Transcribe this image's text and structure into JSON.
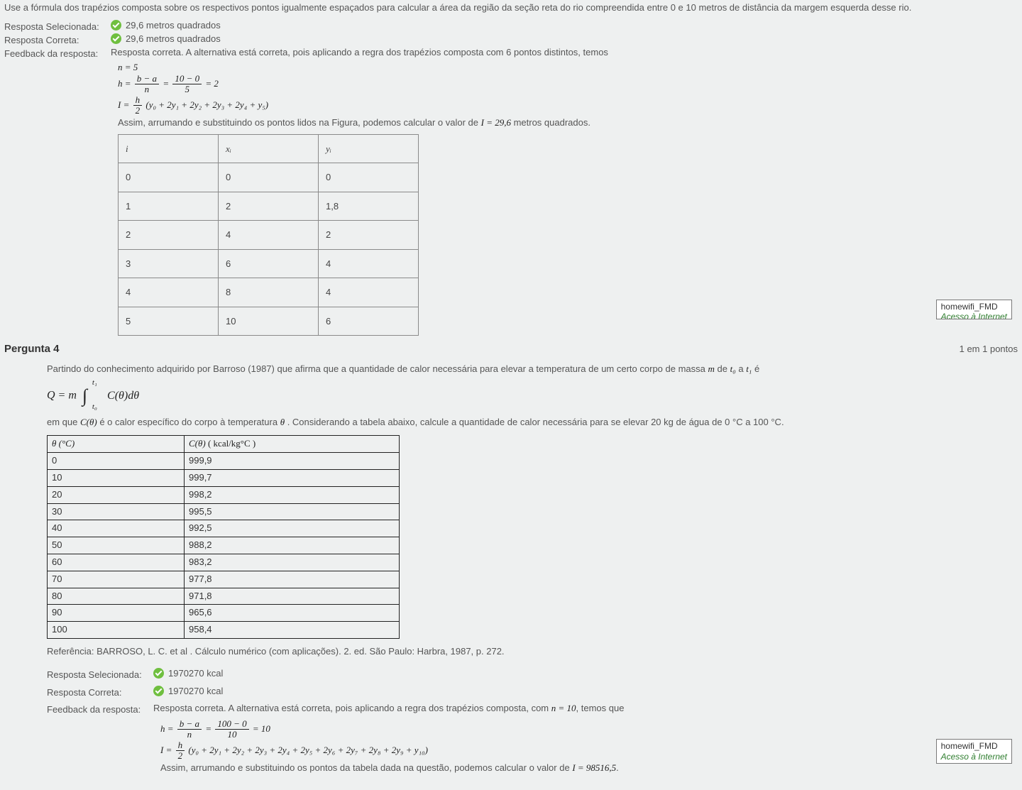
{
  "q3": {
    "prompt": "Use a fórmula dos trapézios composta sobre os respectivos pontos igualmente espaçados para calcular a área da região da seção reta do rio compreendida entre 0 e 10 metros de distância da margem esquerda desse rio.",
    "selected_label": "Resposta Selecionada:",
    "selected_value": "29,6 metros quadrados",
    "correct_label": "Resposta Correta:",
    "correct_value": "29,6 metros quadrados",
    "feedback_label": "Feedback da resposta:",
    "feedback_lead": "Resposta correta. A alternativa está correta, pois aplicando a regra dos trapézios composta com 6 pontos distintos, temos",
    "n_eq": "n = 5",
    "h_lhs": "h =",
    "h_frac_n": "b − a",
    "h_frac_d": "n",
    "h_eq2": "=",
    "h_frac2_n": "10 − 0",
    "h_frac2_d": "5",
    "h_val": "= 2",
    "I_lhs": "I =",
    "I_frac_n": "h",
    "I_frac_d": "2",
    "I_terms": "(y₀ + 2y₁ + 2y₂ + 2y₃ + 2y₄ + y₅)",
    "concl_a": "Assim, arrumando e substituindo os pontos lidos na Figura, podemos calcular o valor de ",
    "concl_b": "I = 29,6",
    "concl_c": " metros quadrados.",
    "table_head": {
      "c0": "i",
      "c1": "xᵢ",
      "c2": "yᵢ"
    },
    "table_rows": [
      {
        "i": "0",
        "x": "0",
        "y": "0"
      },
      {
        "i": "1",
        "x": "2",
        "y": "1,8"
      },
      {
        "i": "2",
        "x": "4",
        "y": "2"
      },
      {
        "i": "3",
        "x": "6",
        "y": "4"
      },
      {
        "i": "4",
        "x": "8",
        "y": "4"
      },
      {
        "i": "5",
        "x": "10",
        "y": "6"
      }
    ]
  },
  "q4": {
    "title": "Pergunta 4",
    "points": "1 em 1 pontos",
    "intro_a": "Partindo do conhecimento adquirido por Barroso (1987)  que afirma que a quantidade de calor necessária para elevar a temperatura de um certo corpo de massa ",
    "intro_m": "m",
    "intro_b": " de ",
    "intro_t0": "t₀",
    "intro_c": " a ",
    "intro_t1": "t₁",
    "intro_d": " é",
    "Q_lhs": "Q = m",
    "int_top": "t₁",
    "int_bot": "t₀",
    "Q_rhs": "C(θ)dθ",
    "def_a": "em que ",
    "def_b": "C(θ)",
    "def_c": " é o calor específico do corpo à temperatura ",
    "def_d": "θ",
    "def_e": " . Considerando a tabela abaixo, calcule a quantidade de calor necessária para se elevar 20 kg de água de 0 °C a 100 °C.",
    "th1": "θ (°C)",
    "th2_a": "C(θ) ",
    "th2_b": "( kcal/kg°C )",
    "rows": [
      {
        "t": "0",
        "c": "999,9"
      },
      {
        "t": "10",
        "c": "999,7"
      },
      {
        "t": "20",
        "c": "998,2"
      },
      {
        "t": "30",
        "c": "995,5"
      },
      {
        "t": "40",
        "c": "992,5"
      },
      {
        "t": "50",
        "c": "988,2"
      },
      {
        "t": "60",
        "c": "983,2"
      },
      {
        "t": "70",
        "c": "977,8"
      },
      {
        "t": "80",
        "c": "971,8"
      },
      {
        "t": "90",
        "c": "965,6"
      },
      {
        "t": "100",
        "c": "958,4"
      }
    ],
    "ref": "Referência: BARROSO, L. C. et al . Cálculo numérico (com aplicações). 2. ed. São Paulo: Harbra, 1987, p. 272.",
    "selected_label": "Resposta Selecionada:",
    "selected_value": "1970270 kcal",
    "correct_label": "Resposta Correta:",
    "correct_value": "1970270 kcal",
    "feedback_label": "Feedback da resposta:",
    "feedback_lead_a": "Resposta correta. A alternativa está correta, pois aplicando a regra dos trapézios composta, com ",
    "feedback_lead_n": "n = 10",
    "feedback_lead_b": ", temos que",
    "h_lhs": "h =",
    "h_frac_n": "b − a",
    "h_frac_d": "n",
    "h_eq2": "=",
    "h_frac2_n": "100 − 0",
    "h_frac2_d": "10",
    "h_val": "= 10",
    "I_lhs": "I =",
    "I_frac_n": "h",
    "I_frac_d": "2",
    "I_terms": "(y₀ + 2y₁ + 2y₂ + 2y₃ + 2y₄ + 2y₅ + 2y₆ + 2y₇ + 2y₈ + 2y₉ + y₁₀)",
    "concl_a": "Assim, arrumando e substituindo os pontos da tabela dada na questão, podemos calcular o valor de ",
    "concl_b": "I = 98516,5",
    "concl_c": "."
  },
  "wifi": {
    "line1": "homewifi_FMD",
    "line2": "Acesso à Internet"
  }
}
